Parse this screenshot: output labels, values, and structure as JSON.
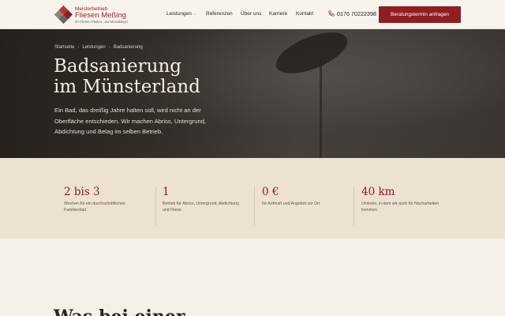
{
  "brand": {
    "line1": "Meisterbetrieb",
    "line2": "Fliesen Meßing",
    "line3": "Ihr Fliesen-Platten- und Mosaikleger"
  },
  "nav": {
    "items": [
      {
        "label": "Leistungen"
      },
      {
        "label": "Referenzen"
      },
      {
        "label": "Über uns"
      },
      {
        "label": "Karriere"
      },
      {
        "label": "Kontakt"
      }
    ],
    "phone": "0176 70222398",
    "cta": "Beratungstermin anfragen"
  },
  "breadcrumb": [
    "Startseite",
    "Leistungen",
    "Badsanierung"
  ],
  "hero": {
    "title_line1": "Badsanierung",
    "title_line2": "im Münsterland",
    "text": "Ein Bad, das dreißig Jahre halten soll, wird nicht an der Oberfläche entschieden. Wir machen Abriss, Untergrund, Abdichtung und Belag im selben Betrieb."
  },
  "stats": [
    {
      "value": "2 bis 3",
      "desc": "Wochen für ein durchschnittliches Familienbad"
    },
    {
      "value": "1",
      "desc": "Betrieb für Abriss, Untergrund, Abdichtung und Fliese"
    },
    {
      "value": "0 €",
      "desc": "für Aufmaß und Angebot vor Ort"
    },
    {
      "value": "40 km",
      "desc": "Umkreis, in dem wir auch für Nacharbeiten kommen"
    }
  ],
  "next_section": {
    "heading_partial": "Was bei einer"
  },
  "colors": {
    "accent": "#8f1d22",
    "stats_bg": "#ebe2d2",
    "hero_bg": "#3a3531"
  }
}
